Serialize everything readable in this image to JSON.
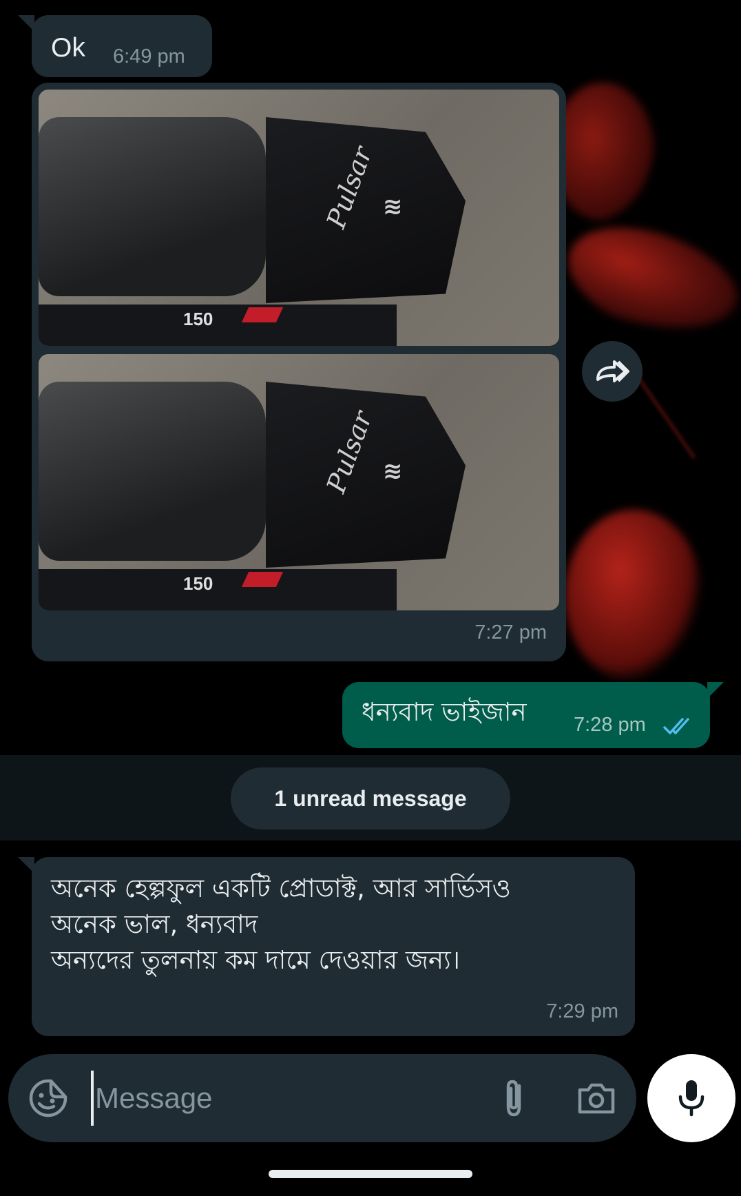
{
  "messages": [
    {
      "direction": "incoming",
      "text": "Ok",
      "time": "6:49 pm"
    },
    {
      "direction": "incoming",
      "type": "photos",
      "time": "7:27 pm",
      "photos": [
        {
          "brand_text": "Pulsar",
          "badge": "150"
        },
        {
          "brand_text": "Pulsar",
          "badge": "150"
        }
      ]
    },
    {
      "direction": "outgoing",
      "text": "ধন্যবাদ ভাইজান",
      "time": "7:28 pm",
      "status": "read"
    },
    {
      "direction": "incoming",
      "lines": [
        "অনেক হেল্পফুল একটি প্রোডাক্ট,  আর সার্ভিসও",
        "অনেক ভাল, ধন্যবাদ",
        "অন্যদের তুলনায় কম দামে দেওয়ার জন্য।"
      ],
      "time": "7:29 pm"
    }
  ],
  "unread_banner": "1 unread message",
  "composer": {
    "placeholder": "Message"
  },
  "icons": {
    "forward": "forward-icon",
    "emoji": "sticker-icon",
    "attach": "paperclip-icon",
    "camera": "camera-icon",
    "mic": "microphone-icon",
    "read_ticks": "double-check-icon"
  },
  "colors": {
    "background": "#000000",
    "incoming_bubble": "#1f2c33",
    "outgoing_bubble": "#005c4b",
    "unread_strip": "#0e1519",
    "read_tick": "#53bdeb",
    "mic_button": "#ffffff"
  }
}
